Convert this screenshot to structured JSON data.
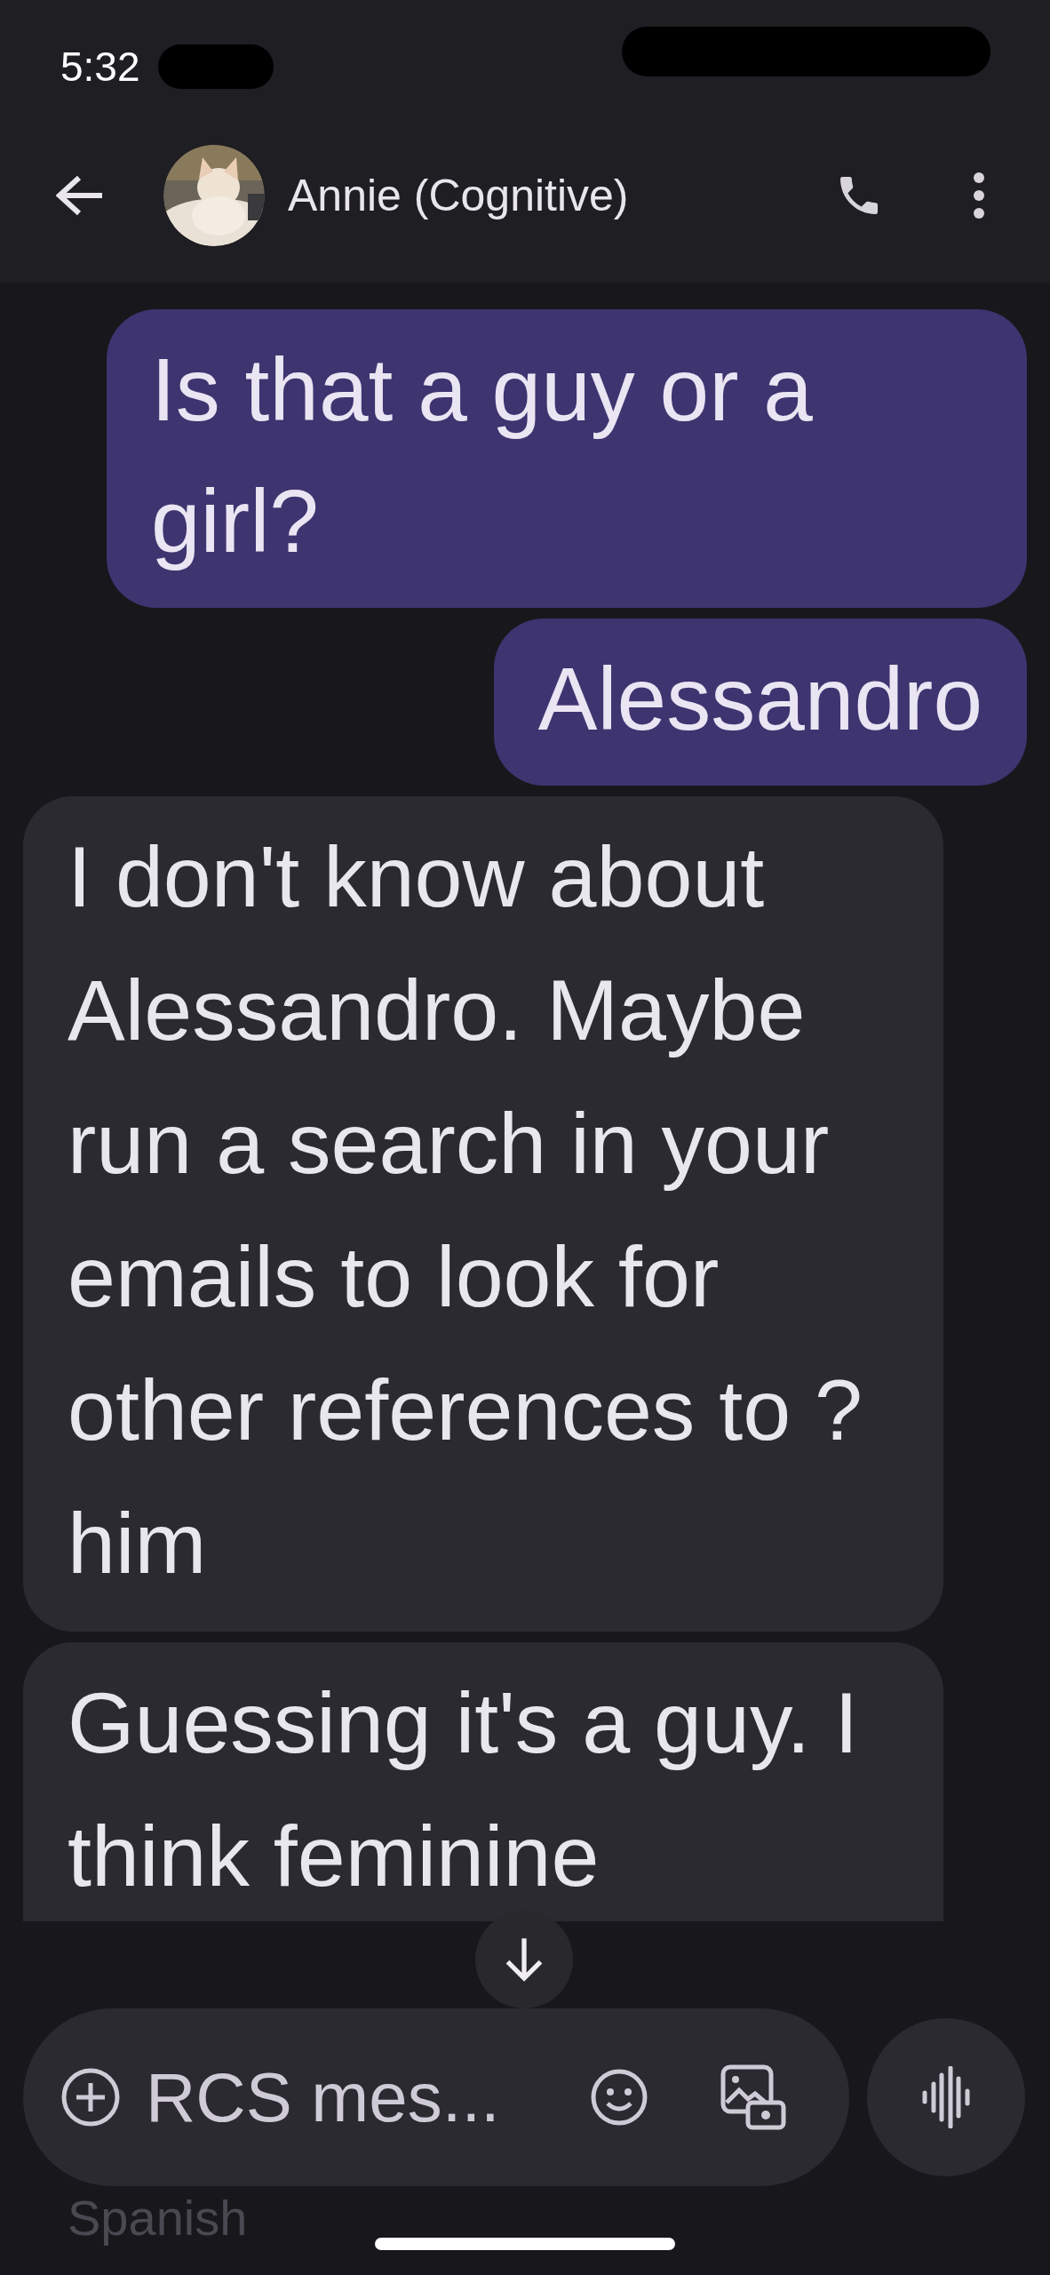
{
  "status_bar": {
    "time": "5:32"
  },
  "header": {
    "contact_name": "Annie (Cognitive)"
  },
  "messages": [
    {
      "kind": "sent",
      "text": "Is that a guy or a girl?"
    },
    {
      "kind": "sent",
      "text": "Alessandro"
    },
    {
      "kind": "received",
      "text": "I don't know about Alessandro. Maybe run a search in your emails to look for other references to ?him"
    },
    {
      "kind": "received",
      "text": "Guessing it's a guy. I think feminine"
    }
  ],
  "composer": {
    "placeholder": "RCS mes..."
  },
  "text_behind_composer": "Spanish"
}
